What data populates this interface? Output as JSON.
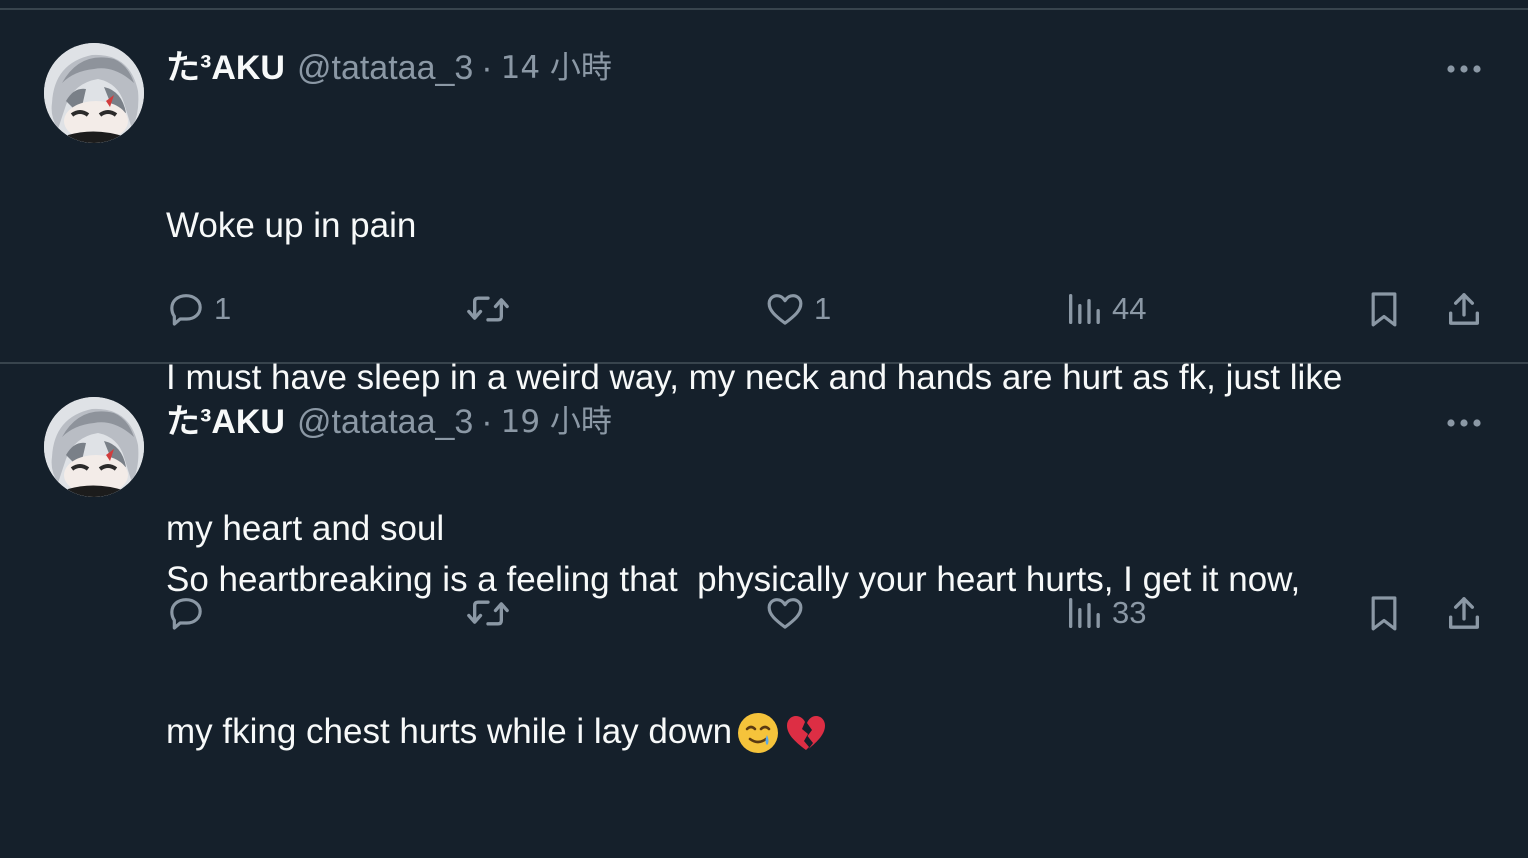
{
  "tweets": [
    {
      "display_name": "た³AKU",
      "handle": "@tatataa_3",
      "separator": "·",
      "time": "14 小時",
      "lines": [
        "Woke up in pain",
        "I must have sleep in a weird way, my neck and hands are hurt as fk, just like",
        "my heart and soul"
      ],
      "emojis": [],
      "reply_count": "1",
      "retweet_count": "",
      "like_count": "1",
      "view_count": "44"
    },
    {
      "display_name": "た³AKU",
      "handle": "@tatataa_3",
      "separator": "·",
      "time": "19 小時",
      "lines": [
        "So heartbreaking is a feeling that  physically your heart hurts, I get it now,",
        "my fking chest hurts while i lay down"
      ],
      "emojis": [
        "smiling-face-with-tear",
        "broken-heart"
      ],
      "reply_count": "",
      "retweet_count": "",
      "like_count": "",
      "view_count": "33"
    }
  ],
  "colors": {
    "background": "#15202b",
    "text": "#f7f9f9",
    "secondary": "#8b98a5",
    "divider": "#38444d"
  }
}
